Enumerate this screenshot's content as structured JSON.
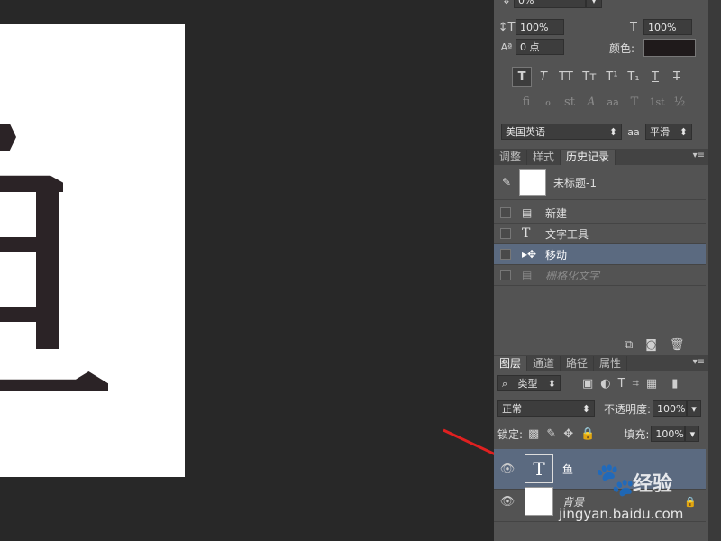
{
  "character_panel": {
    "leading_value": "0%",
    "vertical_scale_value": "100%",
    "horizontal_scale_value": "100%",
    "baseline_shift_value": "0 点",
    "color_label": "颜色:",
    "color_swatch": "#1f1a1b",
    "style_buttons": [
      "T",
      "T",
      "TT",
      "Tt",
      "T¹",
      "T₁",
      "T",
      "T"
    ],
    "opentype_buttons": [
      "fi",
      "ℴ",
      "st",
      "A",
      "aa",
      "T",
      "1st",
      "½"
    ],
    "language_value": "美国英语",
    "aa_icon": "aa",
    "antialias_value": "平滑"
  },
  "history_panel": {
    "tabs": [
      "调整",
      "样式",
      "历史记录"
    ],
    "active_tab": "历史记录",
    "snapshot_label": "未标题-1",
    "items": [
      {
        "label": "新建",
        "icon": "document-icon"
      },
      {
        "label": "文字工具",
        "icon": "text-tool-icon"
      },
      {
        "label": "移动",
        "icon": "move-tool-icon",
        "selected": true
      },
      {
        "label": "栅格化文字",
        "icon": "document-icon",
        "dimmed": true
      }
    ]
  },
  "layers_panel": {
    "tabs": [
      "图层",
      "通道",
      "路径",
      "属性"
    ],
    "active_tab": "图层",
    "filter_label": "类型",
    "blend_mode": "正常",
    "opacity_label": "不透明度:",
    "opacity_value": "100%",
    "lock_label": "锁定:",
    "fill_label": "填充:",
    "fill_value": "100%",
    "layers": [
      {
        "name": "鱼",
        "type": "text",
        "selected": true
      },
      {
        "name": "背景",
        "type": "background",
        "locked": true
      }
    ]
  },
  "watermark": {
    "brand": "经验",
    "url": "jingyan.baidu.com"
  },
  "colors": {
    "accent_selected": "#5b6a80",
    "arrow": "#e02020"
  }
}
